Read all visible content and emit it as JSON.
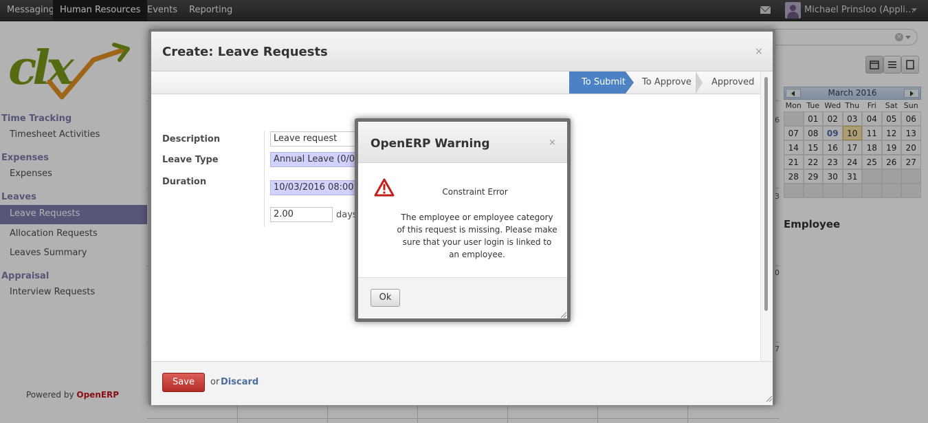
{
  "topbar": {
    "menu": [
      "Messaging",
      "Human Resources",
      "Events",
      "Reporting"
    ],
    "active_menu": "Human Resources",
    "user_name": "Michael Prinsloo (Appli…"
  },
  "sidebar": {
    "logo_text": "clx",
    "sections": [
      {
        "title": "Time Tracking",
        "items": [
          "Timesheet Activities"
        ]
      },
      {
        "title": "Expenses",
        "items": [
          "Expenses"
        ]
      },
      {
        "title": "Leaves",
        "items": [
          "Leave Requests",
          "Allocation Requests",
          "Leaves Summary"
        ]
      },
      {
        "title": "Appraisal",
        "items": [
          "Interview Requests"
        ]
      }
    ],
    "active_item": "Leave Requests",
    "powered_by": "Powered by",
    "powered_brand": "OpenERP"
  },
  "background": {
    "calendar": {
      "month_label": "March 2016",
      "weekdays": [
        "Mon",
        "Tue",
        "Wed",
        "Thu",
        "Fri",
        "Sat",
        "Sun"
      ],
      "weeks": [
        [
          "",
          "01",
          "02",
          "03",
          "04",
          "05",
          "06"
        ],
        [
          "07",
          "08",
          "09",
          "10",
          "11",
          "12",
          "13"
        ],
        [
          "14",
          "15",
          "16",
          "17",
          "18",
          "19",
          "20"
        ],
        [
          "21",
          "22",
          "23",
          "24",
          "25",
          "26",
          "27"
        ],
        [
          "28",
          "29",
          "30",
          "31",
          "",
          "",
          ""
        ],
        [
          "",
          "",
          "",
          "",
          "",
          "",
          ""
        ]
      ],
      "today": "09",
      "highlighted": "10"
    },
    "employee_heading": "Employee",
    "visible_day_numbers": [
      "06",
      "13",
      "20",
      "27"
    ]
  },
  "dialog": {
    "title": "Create: Leave Requests",
    "close_glyph": "×",
    "stages": [
      "To Submit",
      "To Approve",
      "Approved"
    ],
    "active_stage": "To Submit",
    "fields": {
      "description_label": "Description",
      "description_value": "Leave request",
      "leave_type_label": "Leave Type",
      "leave_type_value": "Annual Leave  (0/0)",
      "duration_label": "Duration",
      "duration_start": "10/03/2016 08:00:00",
      "duration_days": "2.00",
      "days_unit": "days"
    },
    "footer": {
      "save_label": "Save",
      "or_text": "or",
      "discard_label": "Discard"
    }
  },
  "warning": {
    "title": "OpenERP Warning",
    "close_glyph": "×",
    "subject": "Constraint Error",
    "message": "The employee or employee category of this request is missing. Please make sure that your user login is linked to an employee.",
    "ok_label": "Ok"
  },
  "colors": {
    "accent": "#7c7bad",
    "stage_active": "#4c82c3",
    "save_button": "#c0372f",
    "required_field": "#d2d2ff",
    "brand_red": "#c8141e"
  }
}
